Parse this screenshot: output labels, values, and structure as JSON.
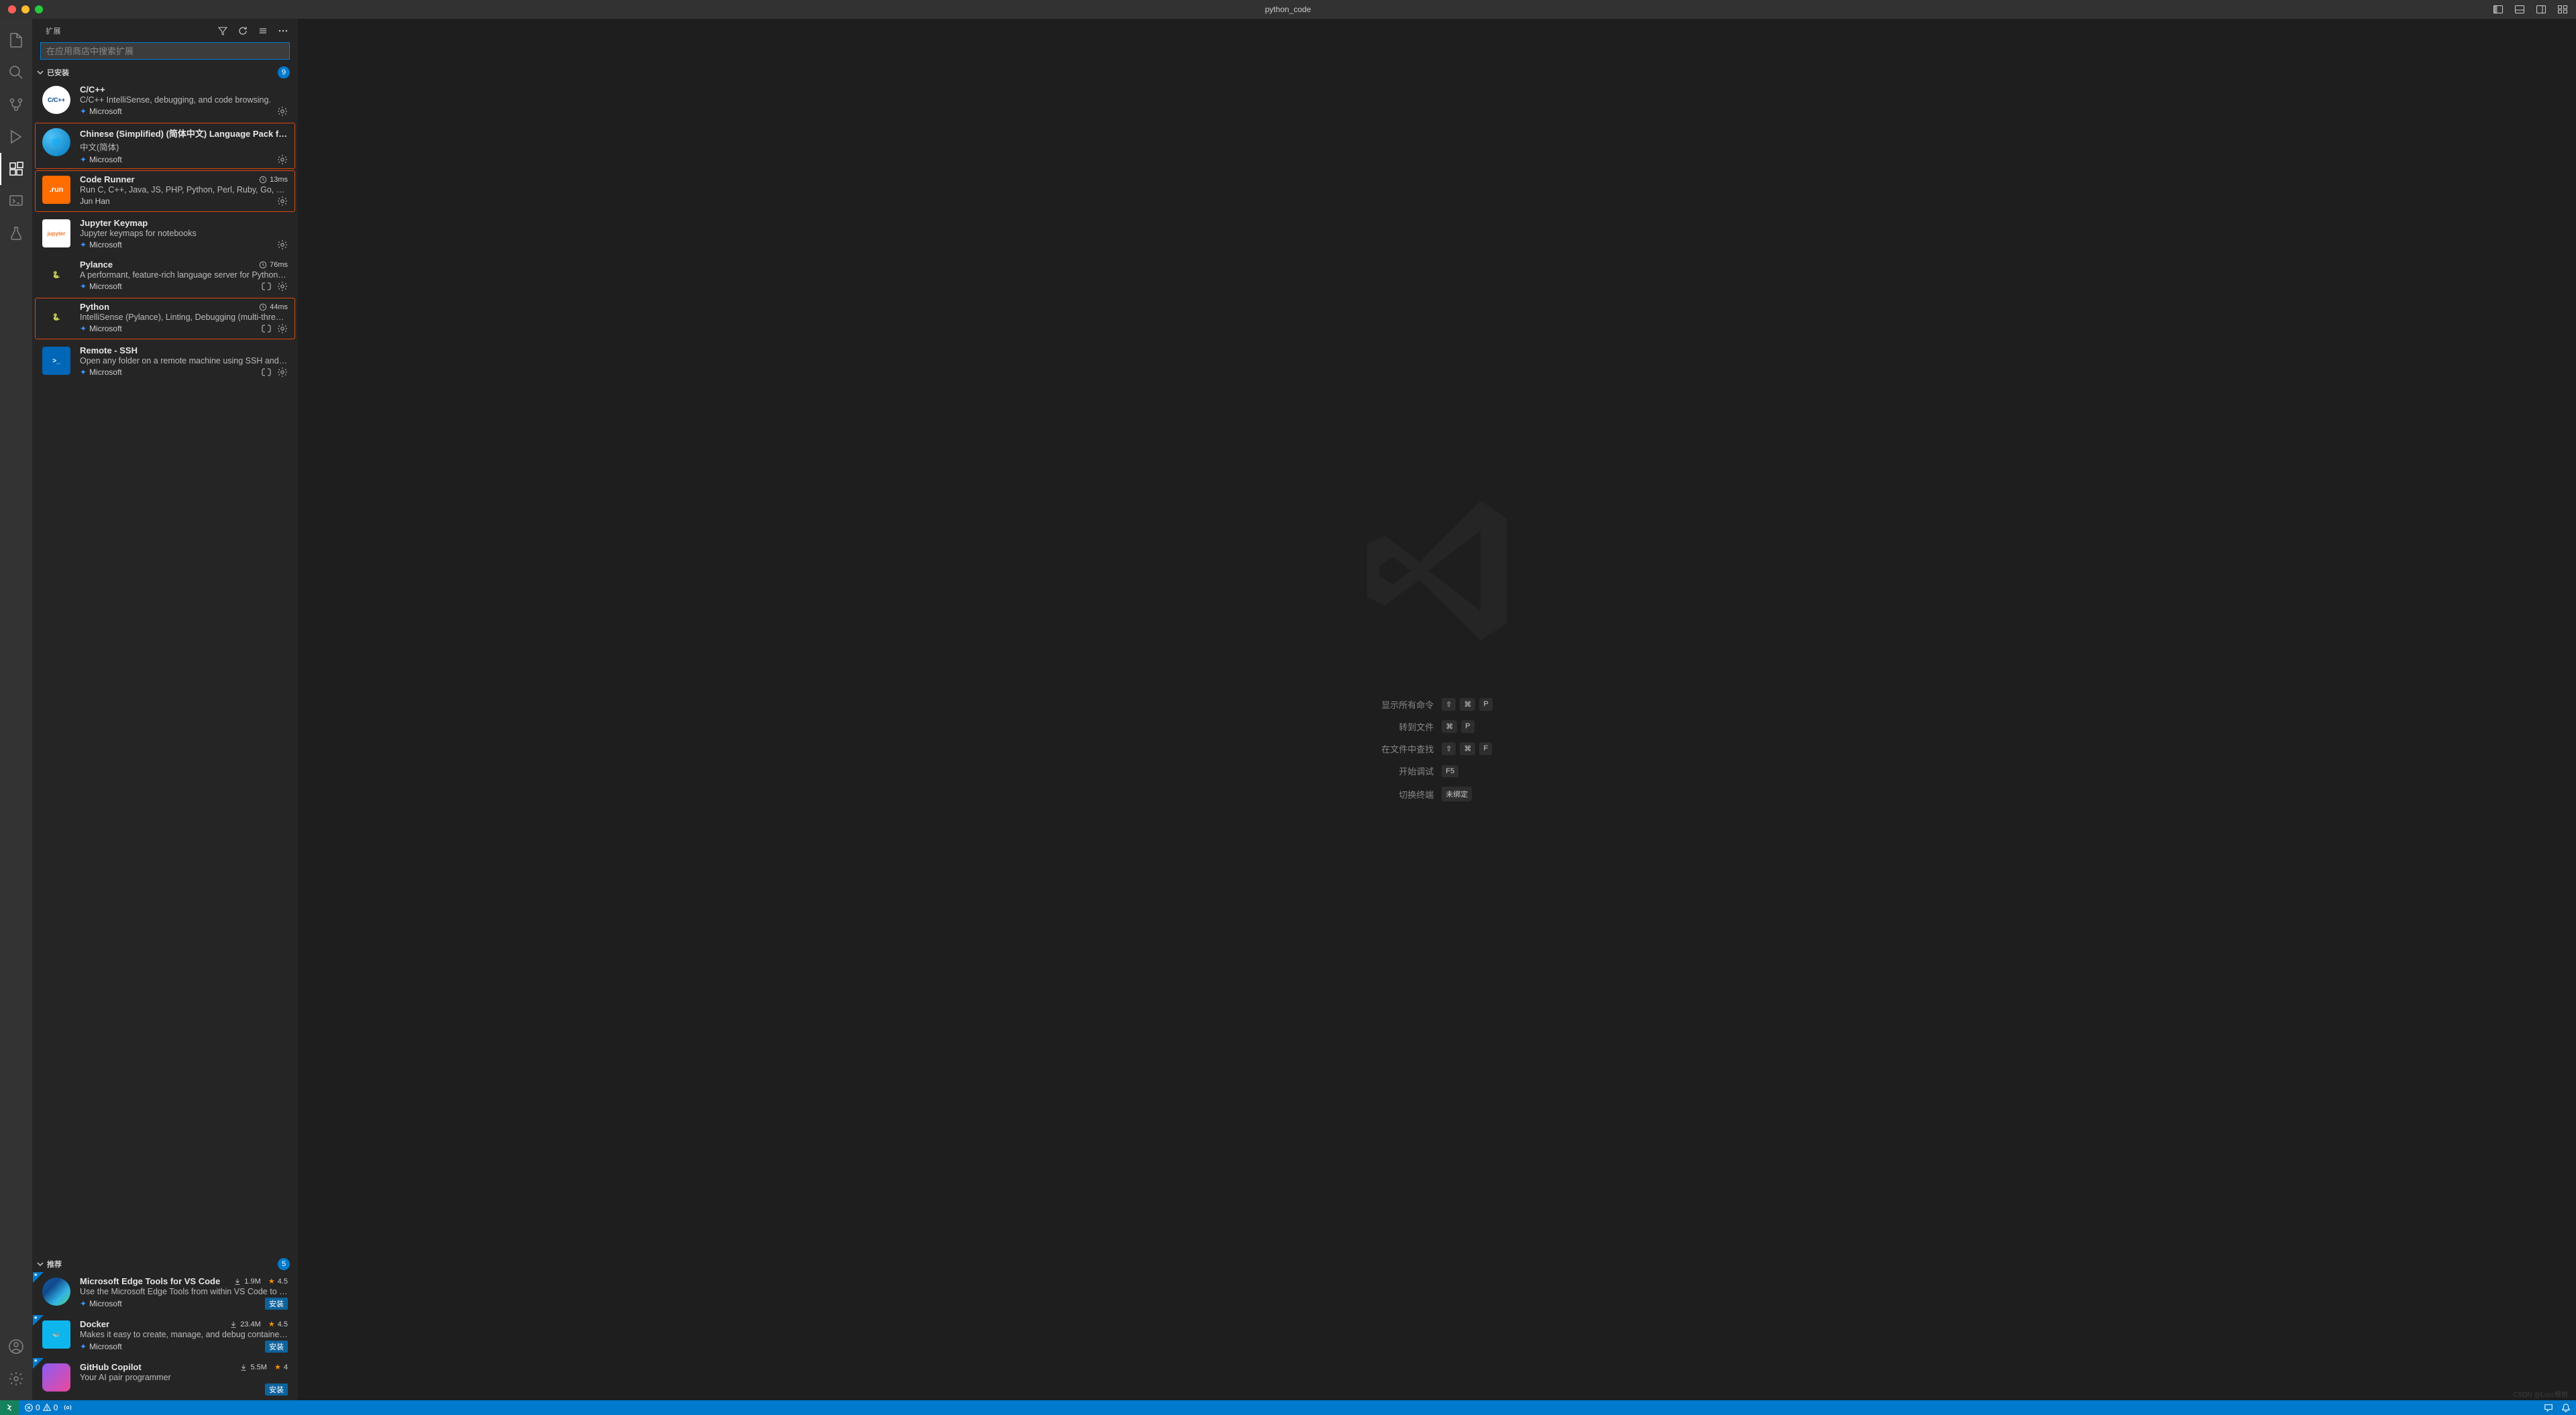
{
  "window": {
    "title": "python_code"
  },
  "sidebar": {
    "title": "扩展",
    "searchPlaceholder": "在应用商店中搜索扩展",
    "sections": {
      "installed": {
        "label": "已安装",
        "count": "9"
      },
      "recommended": {
        "label": "推荐",
        "count": "5"
      }
    }
  },
  "extensions": {
    "installed": [
      {
        "name": "C/C++",
        "desc": "C/C++ IntelliSense, debugging, and code browsing.",
        "publisher": "Microsoft",
        "verified": true,
        "timing": null,
        "highlighted": false,
        "iconClass": "ccpp",
        "iconText": "C/C++",
        "gear": true
      },
      {
        "name": "Chinese (Simplified) (简体中文) Language Pack for V...",
        "desc": "中文(简体)",
        "publisher": "Microsoft",
        "verified": true,
        "timing": null,
        "highlighted": true,
        "iconClass": "globe",
        "iconText": "🌐",
        "gear": true
      },
      {
        "name": "Code Runner",
        "desc": "Run C, C++, Java, JS, PHP, Python, Perl, Ruby, Go, Lua,...",
        "publisher": "Jun Han",
        "verified": false,
        "timing": "13ms",
        "highlighted": true,
        "iconClass": "run",
        "iconText": ".run",
        "gear": true
      },
      {
        "name": "Jupyter Keymap",
        "desc": "Jupyter keymaps for notebooks",
        "publisher": "Microsoft",
        "verified": true,
        "timing": null,
        "highlighted": false,
        "iconClass": "jupyter",
        "iconText": "jupyter",
        "gear": true
      },
      {
        "name": "Pylance",
        "desc": "A performant, feature-rich language server for Python i...",
        "publisher": "Microsoft",
        "verified": true,
        "timing": "76ms",
        "highlighted": false,
        "iconClass": "python",
        "iconText": "🐍",
        "gear": true,
        "sync": true
      },
      {
        "name": "Python",
        "desc": "IntelliSense (Pylance), Linting, Debugging (multi-thread...",
        "publisher": "Microsoft",
        "verified": true,
        "timing": "44ms",
        "highlighted": true,
        "iconClass": "python",
        "iconText": "🐍",
        "gear": true,
        "sync": true
      },
      {
        "name": "Remote - SSH",
        "desc": "Open any folder on a remote machine using SSH and ta...",
        "publisher": "Microsoft",
        "verified": true,
        "timing": null,
        "highlighted": false,
        "iconClass": "ssh",
        "iconText": ">_",
        "gear": true,
        "sync": true
      }
    ],
    "recommended": [
      {
        "name": "Microsoft Edge Tools for VS Code",
        "desc": "Use the Microsoft Edge Tools from within VS Code to s...",
        "publisher": "Microsoft",
        "verified": true,
        "downloads": "1.9M",
        "rating": "4.5",
        "iconClass": "edge",
        "iconText": "",
        "installLabel": "安装"
      },
      {
        "name": "Docker",
        "desc": "Makes it easy to create, manage, and debug containeri...",
        "publisher": "Microsoft",
        "verified": true,
        "downloads": "23.4M",
        "rating": "4.5",
        "iconClass": "docker",
        "iconText": "🐳",
        "installLabel": "安装"
      },
      {
        "name": "GitHub Copilot",
        "desc": "Your AI pair programmer",
        "publisher": "",
        "verified": false,
        "downloads": "5.5M",
        "rating": "4",
        "iconClass": "copilot",
        "iconText": "",
        "installLabel": "安装"
      }
    ]
  },
  "shortcuts": [
    {
      "label": "显示所有命令",
      "keys": [
        "⇧",
        "⌘",
        "P"
      ]
    },
    {
      "label": "转到文件",
      "keys": [
        "⌘",
        "P"
      ]
    },
    {
      "label": "在文件中查找",
      "keys": [
        "⇧",
        "⌘",
        "F"
      ]
    },
    {
      "label": "开始调试",
      "keys": [
        "F5"
      ]
    },
    {
      "label": "切换终端",
      "keys": [
        "未绑定"
      ]
    }
  ],
  "statusbar": {
    "errors": "0",
    "warnings": "0"
  },
  "watermark": "CSDN @Lccc樱桃"
}
